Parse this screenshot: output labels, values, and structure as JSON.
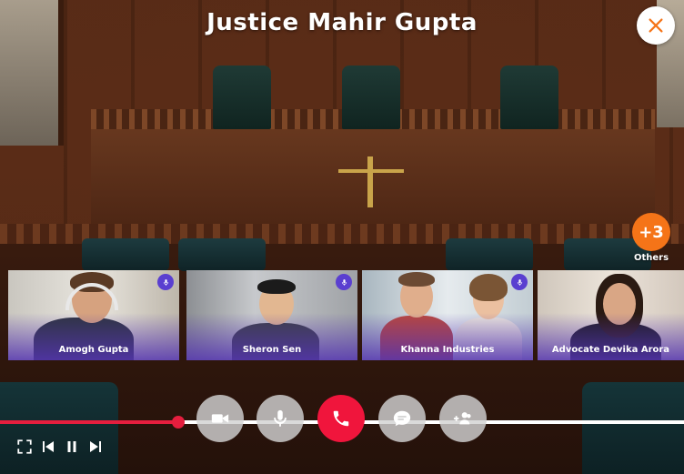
{
  "meeting": {
    "title": "Justice Mahir Gupta"
  },
  "others": {
    "count_label": "+3",
    "label": "Others"
  },
  "participants": [
    {
      "name": "Amogh Gupta",
      "mic_icon": "mic-icon"
    },
    {
      "name": "Sheron Sen",
      "mic_icon": "mic-icon"
    },
    {
      "name": "Khanna Industries",
      "mic_icon": "mic-icon"
    },
    {
      "name": "Advocate Devika Arora",
      "mic_icon": "mic-icon"
    }
  ],
  "controls": [
    {
      "name": "video-camera-icon"
    },
    {
      "name": "microphone-icon"
    },
    {
      "name": "end-call-icon"
    },
    {
      "name": "chat-icon"
    },
    {
      "name": "add-participant-icon"
    }
  ],
  "playback": {
    "progress_fraction": 0.26
  },
  "colors": {
    "accent_red": "#e51e3e",
    "end_call": "#f0153c",
    "others_orange": "#f57418",
    "tile_purple": "#5434b0",
    "close_icon": "#f57418"
  }
}
